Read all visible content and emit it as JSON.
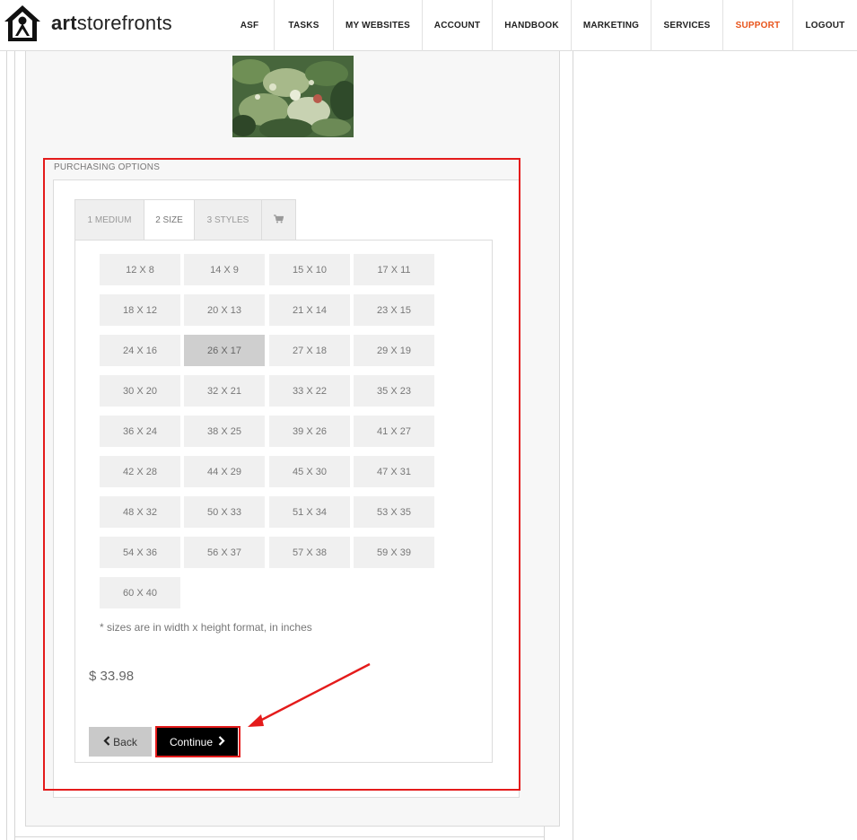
{
  "header": {
    "brand_bold": "art",
    "brand_rest": "storefronts",
    "nav": [
      {
        "label": "ASF"
      },
      {
        "label": "TASKS"
      },
      {
        "label": "MY WEBSITES"
      },
      {
        "label": "ACCOUNT"
      },
      {
        "label": "HANDBOOK"
      },
      {
        "label": "MARKETING"
      },
      {
        "label": "SERVICES"
      },
      {
        "label": "SUPPORT"
      },
      {
        "label": "LOGOUT"
      }
    ],
    "support_color": "#e8541b"
  },
  "purchasing": {
    "legend": "PURCHASING OPTIONS",
    "tabs": [
      {
        "label": "1 MEDIUM"
      },
      {
        "label": "2 SIZE"
      },
      {
        "label": "3 STYLES"
      },
      {
        "icon": "cart-icon"
      }
    ],
    "active_tab": "2 SIZE",
    "sizes": [
      "12 X 8",
      "14 X 9",
      "15 X 10",
      "17 X 11",
      "18 X 12",
      "20 X 13",
      "21 X 14",
      "23 X 15",
      "24 X 16",
      "26 X 17",
      "27 X 18",
      "29 X 19",
      "30 X 20",
      "32 X 21",
      "33 X 22",
      "35 X 23",
      "36 X 24",
      "38 X 25",
      "39 X 26",
      "41 X 27",
      "42 X 28",
      "44 X 29",
      "45 X 30",
      "47 X 31",
      "48 X 32",
      "50 X 33",
      "51 X 34",
      "53 X 35",
      "54 X 36",
      "56 X 37",
      "57 X 38",
      "59 X 39",
      "60 X 40"
    ],
    "selected_size": "26 X 17",
    "note": "* sizes are in width x height format, in inches",
    "price": "$ 33.98",
    "back_label": "Back",
    "continue_label": "Continue"
  },
  "annotation_color": "#e41b1b"
}
